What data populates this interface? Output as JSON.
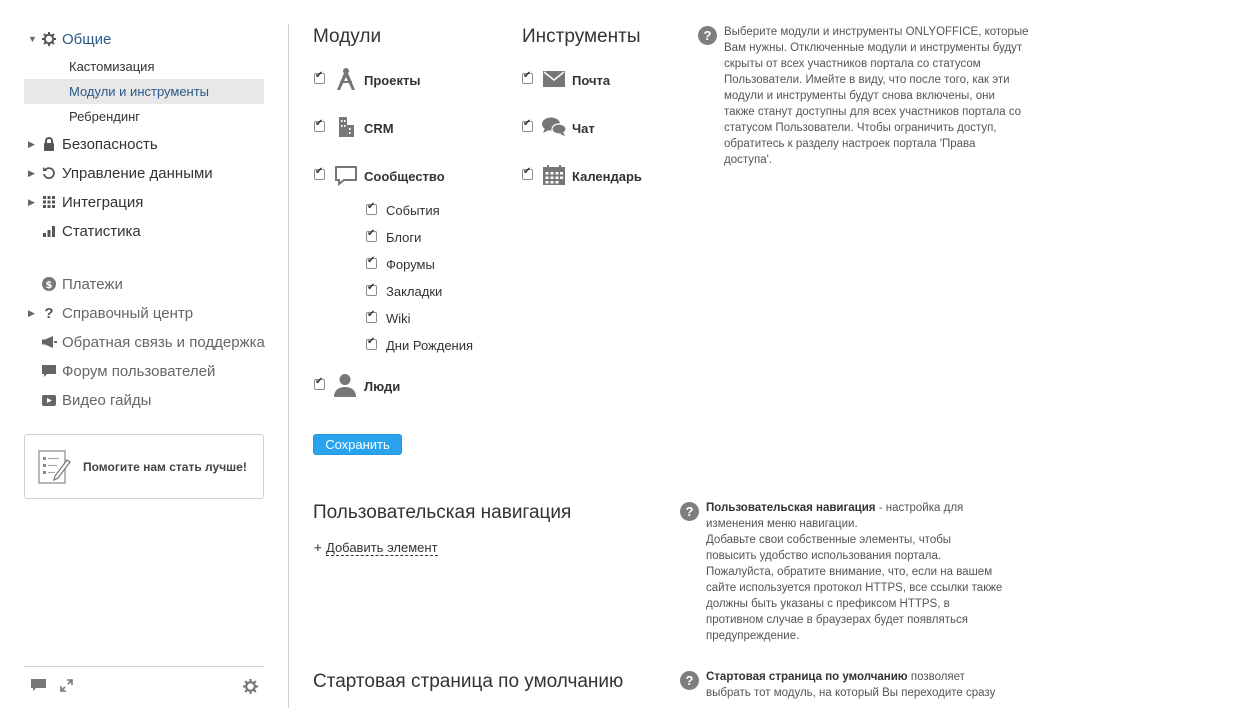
{
  "sidebar": {
    "general": "Общие",
    "sub": [
      "Кастомизация",
      "Модули и инструменты",
      "Ребрендинг"
    ],
    "security": "Безопасность",
    "data_management": "Управление данными",
    "integration": "Интеграция",
    "statistics": "Статистика",
    "payments": "Платежи",
    "help_center": "Справочный центр",
    "feedback": "Обратная связь и поддержка",
    "forum": "Форум пользователей",
    "video": "Видео гайды",
    "help_us": "Помогите нам стать лучше!"
  },
  "modules": {
    "title": "Модули",
    "projects": "Проекты",
    "crm": "CRM",
    "community": "Сообщество",
    "community_sub": [
      "События",
      "Блоги",
      "Форумы",
      "Закладки",
      "Wiki",
      "Дни Рождения"
    ],
    "people": "Люди"
  },
  "tools": {
    "title": "Инструменты",
    "mail": "Почта",
    "chat": "Чат",
    "calendar": "Календарь"
  },
  "save_label": "Сохранить",
  "modules_help": [
    "Выберите модули и инструменты ONLYOFFICE, которые",
    "Вам нужны. Отключенные модули и инструменты будут",
    "скрыты от всех участников портала со статусом",
    "Пользователи. Имейте в виду, что после того, как эти",
    "модули и инструменты будут снова включены, они",
    "также станут доступны для всех участников портала со",
    "статусом Пользователи. Чтобы ограничить доступ,",
    "обратитесь к разделу настроек портала 'Права",
    "доступа'."
  ],
  "custom_nav": {
    "title": "Пользовательская навигация",
    "add_label": "Добавить элемент",
    "help_bold": "Пользовательская навигация",
    "help_first": " - настройка для",
    "help_lines": [
      "изменения меню навигации.",
      "Добавьте свои собственные элементы, чтобы",
      "повысить удобство использования портала.",
      "Пожалуйста, обратите внимание, что, если на вашем",
      "сайте используется протокол HTTPS, все ссылки также",
      "должны быть указаны с префиксом HTTPS, в",
      "противном случае в браузерах будет появляться",
      "предупреждение."
    ]
  },
  "start_page": {
    "title": "Стартовая страница по умолчанию",
    "help_bold": "Стартовая страница по умолчанию",
    "help_first": " позволяет",
    "help_lines": [
      "выбрать тот модуль, на который Вы переходите сразу"
    ]
  }
}
